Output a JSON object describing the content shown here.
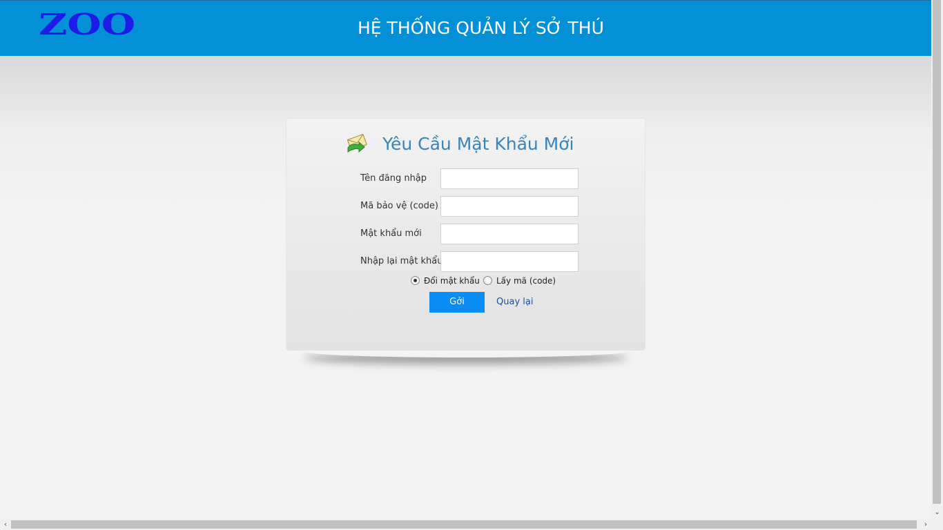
{
  "header": {
    "logo": "ZOO",
    "title": "HỆ THỐNG QUẢN LÝ SỞ THÚ"
  },
  "form": {
    "title": "Yêu Cầu Mật Khẩu Mới",
    "title_icon": "envelope-arrow-icon",
    "fields": [
      {
        "label": "Tên đăng nhập",
        "value": "",
        "placeholder": ""
      },
      {
        "label": "Mã bảo vệ (code)",
        "value": "",
        "placeholder": ""
      },
      {
        "label": "Mật khẩu mới",
        "value": "",
        "placeholder": ""
      },
      {
        "label": "Nhập lại mật khẩu",
        "value": "",
        "placeholder": ""
      }
    ],
    "options": [
      {
        "label": "Đổi mật khẩu",
        "checked": true
      },
      {
        "label": "Lấy mã (code)",
        "checked": false
      }
    ],
    "submit_label": "Gởi",
    "back_label": "Quay lại"
  },
  "scrollbars": {
    "down_arrow": "⌄",
    "left_arrow": "‹",
    "right_arrow": "›"
  },
  "colors": {
    "header_bg": "#0390d6",
    "logo": "#1c1ce6",
    "title": "#3a84b8",
    "button": "#0a8ef5",
    "link": "#1b4f9c"
  }
}
